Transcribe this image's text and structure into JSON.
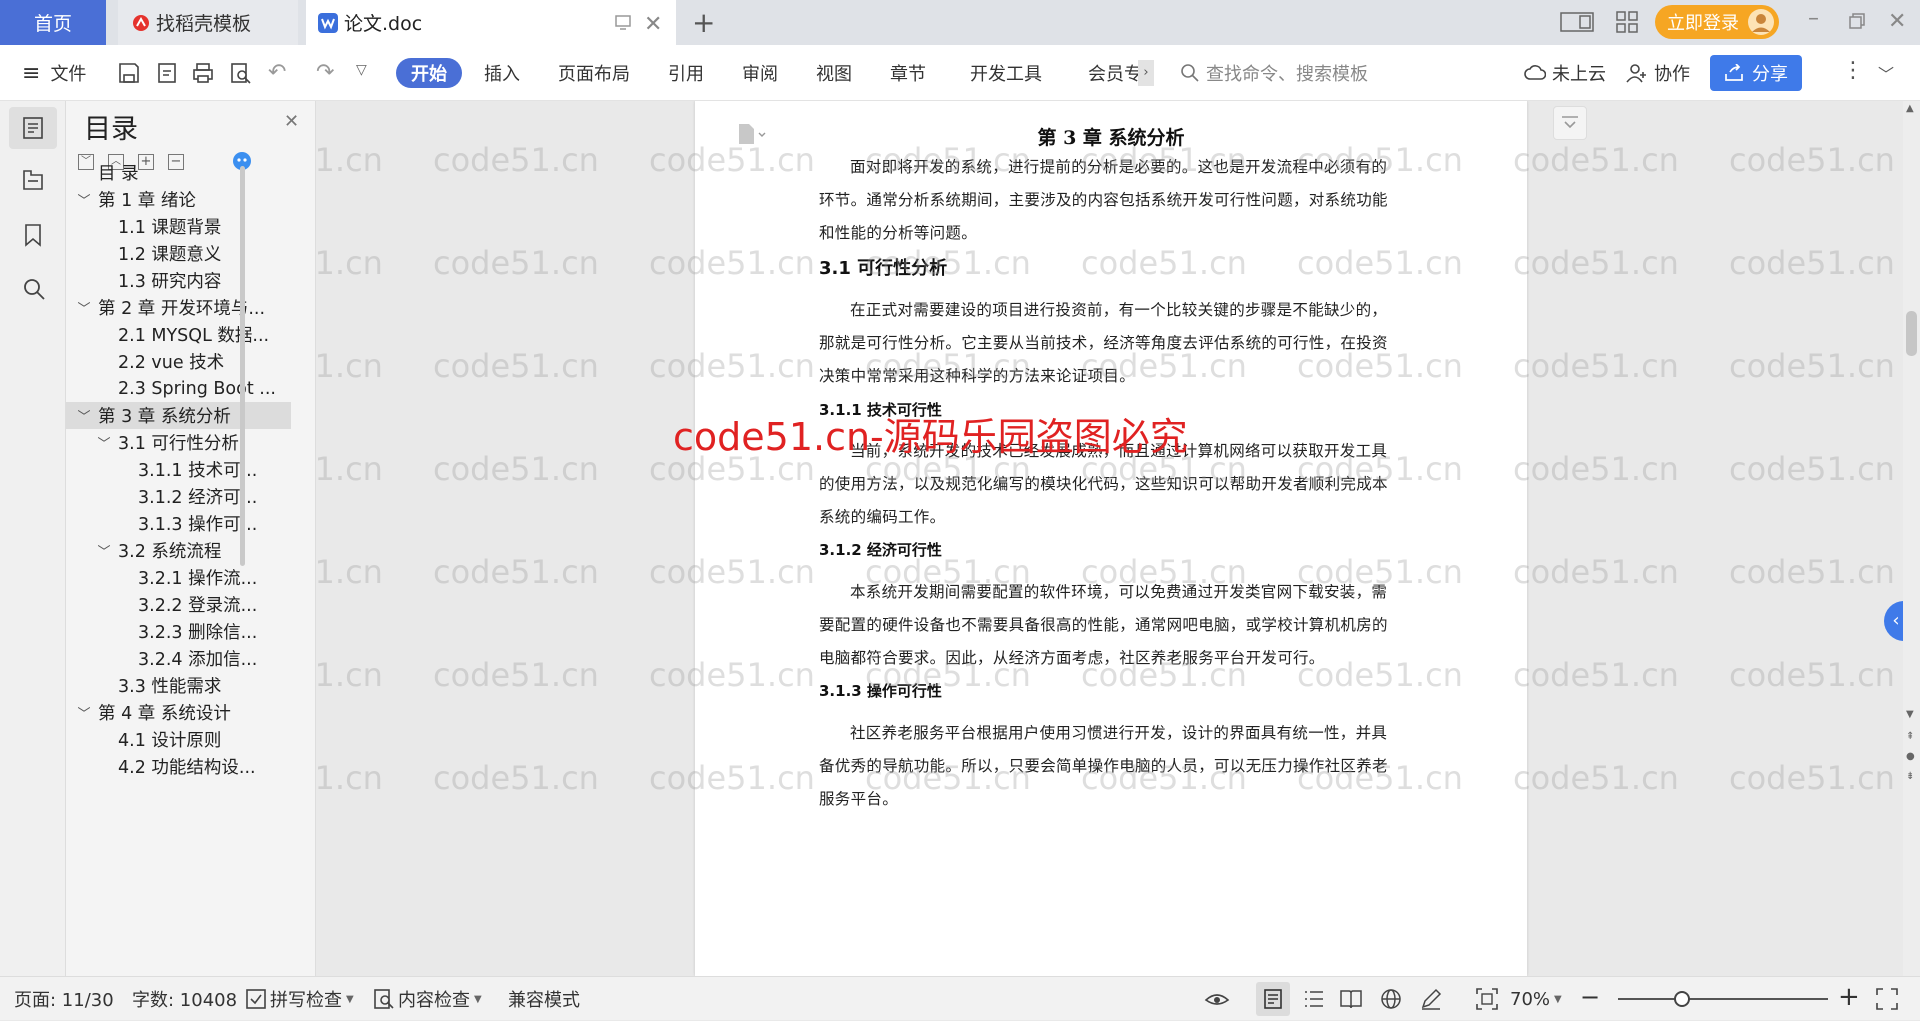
{
  "tabs": {
    "home": "首页",
    "template": "找稻壳模板",
    "doc": "论文.doc"
  },
  "titlebar": {
    "login": "立即登录"
  },
  "toolbar": {
    "file": "文件",
    "ribbon_tabs": [
      "开始",
      "插入",
      "页面布局",
      "引用",
      "审阅",
      "视图",
      "章节",
      "开发工具",
      "会员专"
    ],
    "search_placeholder": "查找命令、搜索模板",
    "cloud": "未上云",
    "collab": "协作",
    "share": "分享"
  },
  "toc": {
    "title": "目录",
    "items": [
      {
        "label": "目  录",
        "level": 0,
        "chevron": false
      },
      {
        "label": "第 1 章  绪论",
        "level": 0,
        "chevron": true
      },
      {
        "label": "1.1  课题背景",
        "level": 1,
        "chevron": false
      },
      {
        "label": "1.2  课题意义",
        "level": 1,
        "chevron": false
      },
      {
        "label": "1.3  研究内容",
        "level": 1,
        "chevron": false
      },
      {
        "label": "第 2 章  开发环境与...",
        "level": 0,
        "chevron": true
      },
      {
        "label": "2.1 MYSQL 数据...",
        "level": 1,
        "chevron": false
      },
      {
        "label": "2.2 vue 技术",
        "level": 1,
        "chevron": false
      },
      {
        "label": "2.3 Spring Boot ...",
        "level": 1,
        "chevron": false
      },
      {
        "label": "第 3 章  系统分析",
        "level": 0,
        "chevron": true,
        "selected": true
      },
      {
        "label": "3.1  可行性分析",
        "level": 1,
        "chevron": true
      },
      {
        "label": "3.1.1  技术可...",
        "level": 2,
        "chevron": false
      },
      {
        "label": "3.1.2  经济可...",
        "level": 2,
        "chevron": false
      },
      {
        "label": "3.1.3  操作可...",
        "level": 2,
        "chevron": false
      },
      {
        "label": "3.2  系统流程",
        "level": 1,
        "chevron": true
      },
      {
        "label": "3.2.1  操作流...",
        "level": 2,
        "chevron": false
      },
      {
        "label": "3.2.2  登录流...",
        "level": 2,
        "chevron": false
      },
      {
        "label": "3.2.3  删除信...",
        "level": 2,
        "chevron": false
      },
      {
        "label": "3.2.4  添加信...",
        "level": 2,
        "chevron": false
      },
      {
        "label": "3.3  性能需求",
        "level": 1,
        "chevron": false
      },
      {
        "label": "第 4 章  系统设计",
        "level": 0,
        "chevron": true
      },
      {
        "label": "4.1  设计原则",
        "level": 1,
        "chevron": false
      },
      {
        "label": "4.2  功能结构设...",
        "level": 1,
        "chevron": false
      }
    ]
  },
  "document": {
    "chapter_title": "第 3 章  系统分析",
    "intro": "面对即将开发的系统，进行提前的分析是必要的。这也是开发流程中必须有的环节。通常分析系统期间，主要涉及的内容包括系统开发可行性问题，对系统功能和性能的分析等问题。",
    "h_31": "3.1  可行性分析",
    "p_31": "在正式对需要建设的项目进行投资前，有一个比较关键的步骤是不能缺少的，那就是可行性分析。它主要从当前技术，经济等角度去评估系统的可行性，在投资决策中常常采用这种科学的方法来论证项目。",
    "h_311": "3.1.1  技术可行性",
    "p_311": "当前，系统开发的技术已经发展成熟，而且通过计算机网络可以获取开发工具的使用方法，以及规范化编写的模块化代码，这些知识可以帮助开发者顺利完成本系统的编码工作。",
    "h_312": "3.1.2  经济可行性",
    "p_312": "本系统开发期间需要配置的软件环境，可以免费通过开发类官网下载安装，需要配置的硬件设备也不需要具备很高的性能，通常网吧电脑，或学校计算机机房的电脑都符合要求。因此，从经济方面考虑，社区养老服务平台开发可行。",
    "h_313": "3.1.3  操作可行性",
    "p_313": "社区养老服务平台根据用户使用习惯进行开发，设计的界面具有统一性，并具备优秀的导航功能。所以，只要会简单操作电脑的人员，可以无压力操作社区养老服务平台。"
  },
  "watermark": {
    "small": "code51.cn",
    "large": "code51.cn-源码乐园盗图必究"
  },
  "status": {
    "page": "页面: 11/30",
    "words": "字数: 10408",
    "spell": "拼写检查",
    "content_check": "内容检查",
    "compat": "兼容模式",
    "zoom": "70%"
  }
}
